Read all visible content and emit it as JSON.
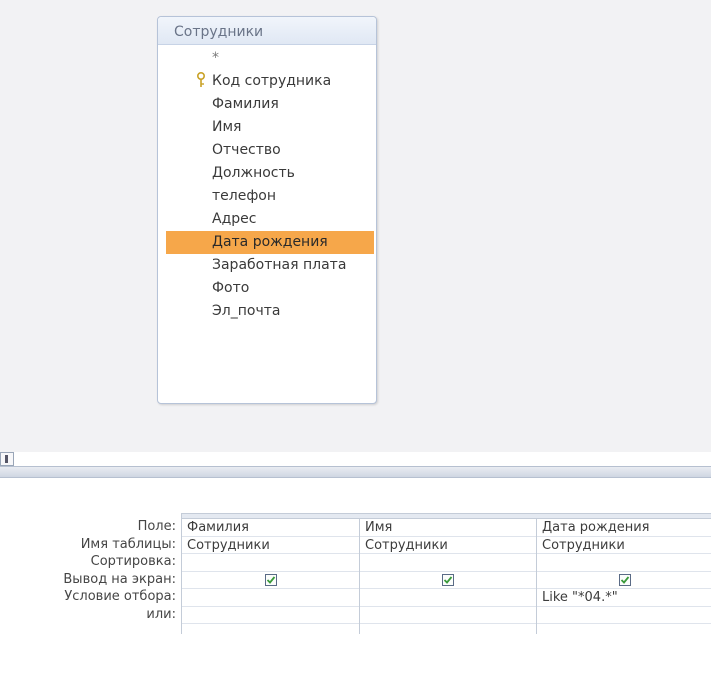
{
  "table": {
    "title": "Сотрудники",
    "star": "*",
    "fields": [
      {
        "label": "Код сотрудника",
        "primary_key": true
      },
      {
        "label": "Фамилия"
      },
      {
        "label": "Имя"
      },
      {
        "label": "Отчество"
      },
      {
        "label": "Должность"
      },
      {
        "label": "телефон"
      },
      {
        "label": "Адрес"
      },
      {
        "label": "Дата рождения",
        "selected": true
      },
      {
        "label": "Заработная плата"
      },
      {
        "label": "Фото"
      },
      {
        "label": "Эл_почта"
      }
    ]
  },
  "grid": {
    "row_labels": {
      "field": "Поле:",
      "table": "Имя таблицы:",
      "sort": "Сортировка:",
      "show": "Вывод на экран:",
      "criteria": "Условие отбора:",
      "or": "или:"
    },
    "columns": [
      {
        "field": "Фамилия",
        "table": "Сотрудники",
        "sort": "",
        "show": true,
        "criteria": "",
        "or": ""
      },
      {
        "field": "Имя",
        "table": "Сотрудники",
        "sort": "",
        "show": true,
        "criteria": "",
        "or": ""
      },
      {
        "field": "Дата рождения",
        "table": "Сотрудники",
        "sort": "",
        "show": true,
        "criteria": "Like \"*04.*\"",
        "or": ""
      }
    ]
  },
  "colors": {
    "selected_field": "#f6a74a",
    "check": "#3a9a3a"
  },
  "icons": {
    "primary_key": "key-icon",
    "checkbox_checked": "checkmark-icon"
  }
}
